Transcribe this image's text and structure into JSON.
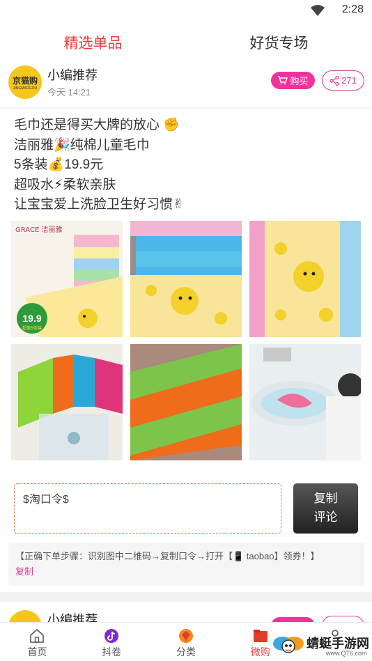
{
  "status_bar": {
    "time": "2:28"
  },
  "tabs": [
    {
      "label": "精选单品",
      "active": true
    },
    {
      "label": "好货专场",
      "active": false
    }
  ],
  "post": {
    "author": "小编推荐",
    "time": "今天 14:21",
    "logo_text": "京猫购",
    "logo_sub": "JINGMAOGOU",
    "buy_label": "购买",
    "share_count": "271",
    "lines": [
      "毛巾还是得买大牌的放心 ✊",
      "洁丽雅🎉纯棉儿童毛巾",
      "5条装💰19.9元",
      "超吸水⚡柔软亲肤",
      "让宝宝爱上洗脸卫生好习惯✌"
    ],
    "images": [
      {
        "name": "grace-towel-pack",
        "brand": "GRACE 洁丽雅",
        "price": "19.9",
        "promo": "超值5条装"
      },
      {
        "name": "stacked-towels"
      },
      {
        "name": "duck-towel-closeup"
      },
      {
        "name": "striped-towels-bag"
      },
      {
        "name": "striped-towel-closeup"
      },
      {
        "name": "child-washing-face"
      }
    ],
    "code_text": "$淘口令$",
    "copy_comment_label": [
      "复制",
      "评论"
    ],
    "tips_text": "【正确下单步骤：识别图中二维码→复制口令→打开【📱 taobao】领券！】",
    "tips_copy": "复制"
  },
  "post2": {
    "author": "小编推荐"
  },
  "bottom_nav": [
    {
      "label": "首页",
      "icon": "home-icon",
      "active": false
    },
    {
      "label": "抖卷",
      "icon": "tiktok-icon",
      "active": false
    },
    {
      "label": "分类",
      "icon": "category-icon",
      "active": false
    },
    {
      "label": "微购",
      "icon": "wechat-shop-icon",
      "active": true
    },
    {
      "label": "",
      "icon": "profile-icon",
      "active": false
    }
  ],
  "watermark": {
    "text": "蜻蜓手游网",
    "url": "www.QT6.com"
  },
  "colors": {
    "accent": "#ef3b3b",
    "pink": "#f0339b",
    "logo_yellow": "#f5c61c"
  }
}
